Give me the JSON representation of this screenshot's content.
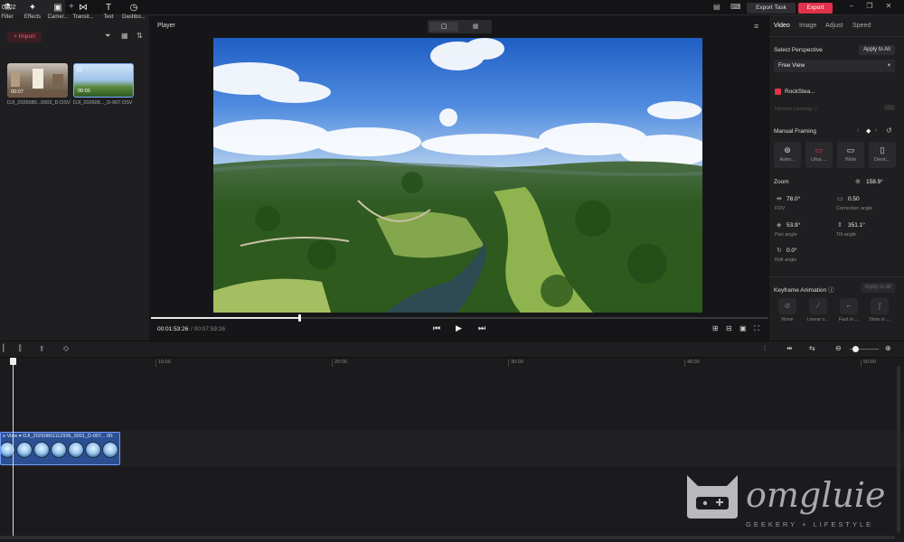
{
  "titlebar": {
    "tab_label": "0802",
    "tab_close": "×",
    "new_tab": "+",
    "export_task_label": "Export Task",
    "export_label": "Export",
    "minimize": "−",
    "restore": "❐",
    "close": "✕"
  },
  "toolbar": {
    "items": [
      {
        "label": "Filter",
        "icon": "filter-icon",
        "glyph": "⚗"
      },
      {
        "label": "Effects",
        "icon": "effects-icon",
        "glyph": "✦"
      },
      {
        "label": "Camer...",
        "icon": "camera-icon",
        "glyph": "▣"
      },
      {
        "label": "Transit...",
        "icon": "transition-icon",
        "glyph": "⋈"
      },
      {
        "label": "Text",
        "icon": "text-icon",
        "glyph": "T"
      },
      {
        "label": "Dashbo...",
        "icon": "dashboard-icon",
        "glyph": "◷"
      }
    ]
  },
  "media": {
    "import_label": "+ Import",
    "clips": [
      {
        "name": "DJI_2026080...0002_D.OSV",
        "duration": "00:07"
      },
      {
        "name": "DJI_202608..._D-007.OSV",
        "duration": "00:00"
      }
    ]
  },
  "player": {
    "title": "Player",
    "current_time": "00:01:53:26",
    "total_time": "/ 00:07:59:26",
    "progress": 0.24
  },
  "right_panel": {
    "tabs": [
      "Video",
      "Image",
      "Adjust",
      "Speed"
    ],
    "active_tab": "Video",
    "select_perspective": "Select Perspective",
    "apply_to_all": "Apply to All",
    "perspective_value": "Free View",
    "rocksteady": "RockStea...",
    "horizon_leveling": "Horizon Leveling ⓘ",
    "manual_framing": "Manual Framing",
    "framing_options": [
      {
        "label": "Aster...",
        "glyph": "⊛"
      },
      {
        "label": "Ultra ...",
        "glyph": "▭"
      },
      {
        "label": "Wide",
        "glyph": "▭"
      },
      {
        "label": "Devic...",
        "glyph": "▯"
      }
    ],
    "zoom_label": "Zoom",
    "zoom_value": "158.9°",
    "fov_value": "78.0°",
    "fov_label": "FOV",
    "correction_value": "0.50",
    "correction_label": "Correction angle",
    "pan_value": "53.9°",
    "pan_label": "Pan angle",
    "tilt_value": "351.1°",
    "tilt_label": "Tilt angle",
    "roll_value": "0.0°",
    "roll_label": "Roll angle",
    "keyframe_label": "Keyframe Animation ⓘ",
    "keyframe_apply": "Apply to all",
    "keyframe_options": [
      "None",
      "Linear s...",
      "Fast in ...",
      "Slow in ..."
    ]
  },
  "timeline": {
    "ticks": [
      "10:00",
      "20:00",
      "30:00",
      "40:00",
      "50:00"
    ],
    "clip_label": "e View ▾   DJI_20260801112936_0001_D-007...   00:",
    "zoom_level": 0.2
  },
  "watermark": {
    "name": "omgluie",
    "tagline": "GEEKERY + LIFESTYLE"
  },
  "colors": {
    "accent": "#e0334b",
    "clip": "#2b4f93",
    "background": "#1b1b1d"
  }
}
